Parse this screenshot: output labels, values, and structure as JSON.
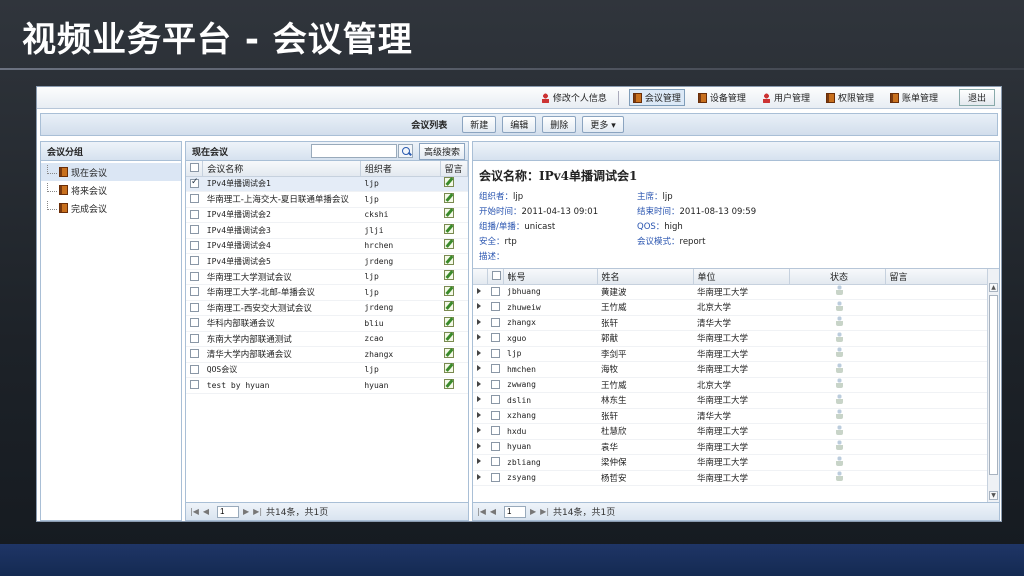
{
  "slide_title": "视频业务平台 - 会议管理",
  "topnav": {
    "items": [
      {
        "label": "修改个人信息",
        "icon": "user-icon"
      },
      {
        "label": "会议管理",
        "icon": "book-icon",
        "active": true
      },
      {
        "label": "设备管理",
        "icon": "book-icon"
      },
      {
        "label": "用户管理",
        "icon": "user-icon"
      },
      {
        "label": "权限管理",
        "icon": "book-icon"
      },
      {
        "label": "账单管理",
        "icon": "book-icon"
      }
    ],
    "exit": "退出"
  },
  "toolbar": {
    "title": "会议列表",
    "new": "新建",
    "edit": "编辑",
    "delete": "删除",
    "more": "更多"
  },
  "left": {
    "header": "会议分组",
    "items": [
      "现在会议",
      "将来会议",
      "完成会议"
    ]
  },
  "mid": {
    "header": "现在会议",
    "search_placeholder": "",
    "advanced": "高级搜索",
    "columns": [
      "会议名称",
      "组织者",
      "留言"
    ],
    "rows": [
      {
        "name": "IPv4单播调试会1",
        "org": "ljp",
        "checked": true
      },
      {
        "name": "华南理工-上海交大-夏日联通单播会议",
        "org": "ljp"
      },
      {
        "name": "IPv4单播调试会2",
        "org": "ckshi"
      },
      {
        "name": "IPv4单播调试会3",
        "org": "jlji"
      },
      {
        "name": "IPv4单播调试会4",
        "org": "hrchen"
      },
      {
        "name": "IPv4单播调试会5",
        "org": "jrdeng"
      },
      {
        "name": "华南理工大学测试会议",
        "org": "ljp"
      },
      {
        "name": "华南理工大学-北邮-单播会议",
        "org": "ljp"
      },
      {
        "name": "华南理工-西安交大测试会议",
        "org": "jrdeng"
      },
      {
        "name": "华科内部联通会议",
        "org": "bliu"
      },
      {
        "name": "东南大学内部联通测试",
        "org": "zcao"
      },
      {
        "name": "清华大学内部联通会议",
        "org": "zhangx"
      },
      {
        "name": "QOS会议",
        "org": "ljp"
      },
      {
        "name": "test by hyuan",
        "org": "hyuan"
      }
    ],
    "pager": {
      "page": "1",
      "summary": "共14条，共1页"
    }
  },
  "right": {
    "title": "会议名称：IPv4单播调试会1",
    "fields": [
      {
        "label": "组织者：",
        "value": "ljp"
      },
      {
        "label": "主席：",
        "value": "ljp"
      },
      {
        "label": "开始时间：",
        "value": "2011-04-13 09:01"
      },
      {
        "label": "结束时间：",
        "value": "2011-08-13 09:59"
      },
      {
        "label": "组播/单播：",
        "value": "unicast"
      },
      {
        "label": "QOS：",
        "value": "high"
      },
      {
        "label": "安全：",
        "value": "rtp"
      },
      {
        "label": "会议模式：",
        "value": "report"
      },
      {
        "label": "描述：",
        "value": ""
      },
      {
        "label": "",
        "value": ""
      }
    ],
    "columns": [
      "帐号",
      "姓名",
      "单位",
      "状态",
      "留言"
    ],
    "members": [
      {
        "acct": "jbhuang",
        "name": "黄建波",
        "unit": "华南理工大学"
      },
      {
        "acct": "zhuweiw",
        "name": "王竹威",
        "unit": "北京大学"
      },
      {
        "acct": "zhangx",
        "name": "张轩",
        "unit": "清华大学"
      },
      {
        "acct": "xguo",
        "name": "郭献",
        "unit": "华南理工大学"
      },
      {
        "acct": "ljp",
        "name": "李剑平",
        "unit": "华南理工大学"
      },
      {
        "acct": "hmchen",
        "name": "海牧",
        "unit": "华南理工大学"
      },
      {
        "acct": "zwwang",
        "name": "王竹威",
        "unit": "北京大学"
      },
      {
        "acct": "dslin",
        "name": "林东生",
        "unit": "华南理工大学"
      },
      {
        "acct": "xzhang",
        "name": "张轩",
        "unit": "清华大学"
      },
      {
        "acct": "hxdu",
        "name": "杜慧欣",
        "unit": "华南理工大学"
      },
      {
        "acct": "hyuan",
        "name": "袁华",
        "unit": "华南理工大学"
      },
      {
        "acct": "zbliang",
        "name": "梁仲保",
        "unit": "华南理工大学"
      },
      {
        "acct": "zsyang",
        "name": "杨哲安",
        "unit": "华南理工大学"
      }
    ],
    "pager": {
      "page": "1",
      "summary": "共14条，共1页"
    }
  }
}
